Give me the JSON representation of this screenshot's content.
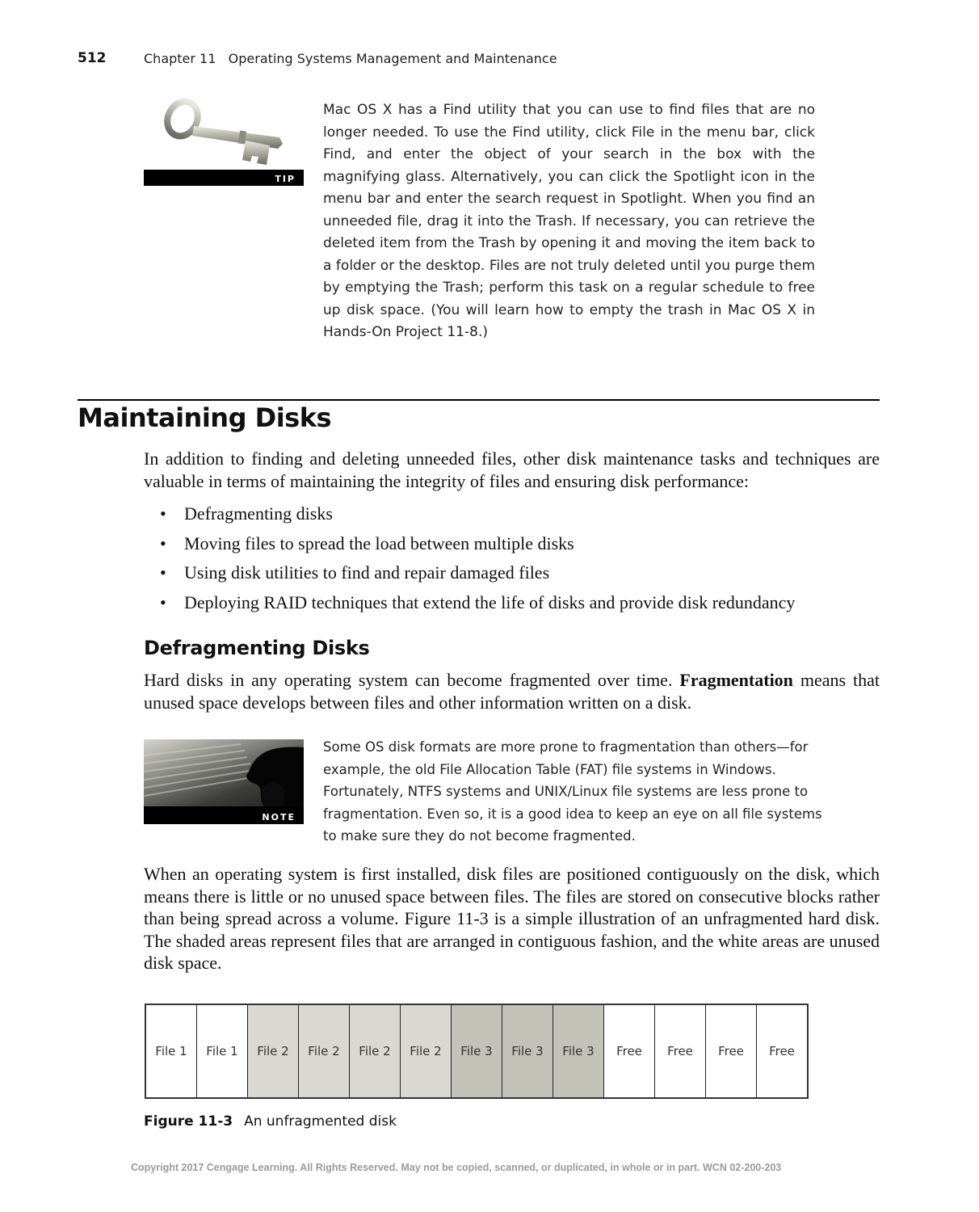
{
  "header": {
    "page_number": "512",
    "chapter_title": "Chapter 11   Operating Systems Management and Maintenance"
  },
  "tip": {
    "icon": "key-icon",
    "badge": "TIP",
    "text": "Mac OS X has a Find utility that you can use to find files that are no longer needed. To use the Find utility, click File in the menu bar, click Find, and enter the object of your search in the box with the magnifying glass. Alternatively, you can click the Spotlight icon in the menu bar and enter the search request in Spotlight. When you find an unneeded file, drag it into the Trash. If necessary, you can retrieve the deleted item from the Trash by opening it and moving the item back to a folder or the desktop. Files are not truly deleted until you purge them by emptying the Trash; perform this task on a regular schedule to free up disk space. (You will learn how to empty the trash in Mac OS X in Hands-On Project 11-8.)"
  },
  "section": {
    "title": "Maintaining Disks",
    "intro": "In addition to finding and deleting unneeded files, other disk maintenance tasks and techniques are valuable in terms of maintaining the integrity of files and ensuring disk performance:",
    "bullets": [
      "Defragmenting disks",
      "Moving files to spread the load between multiple disks",
      "Using disk utilities to find and repair damaged files",
      "Deploying RAID techniques that extend the life of disks and provide disk redundancy"
    ]
  },
  "subsection": {
    "title": "Defragmenting Disks",
    "para_before": "Hard disks in any operating system can become fragmented over time. ",
    "term": "Fragmentation",
    "para_after": " means that unused space develops between files and other information written on a disk."
  },
  "note": {
    "icon": "keyboard-hand-icon",
    "badge": "NOTE",
    "text": "Some OS disk formats are more prone to fragmentation than others—for example, the old File Allocation Table (FAT) file systems in Windows. Fortunately, NTFS systems and UNIX/Linux file systems are less prone to fragmentation. Even so, it is a good idea to keep an eye on all file systems to make sure they do not become fragmented."
  },
  "install_para": "When an operating system is first installed, disk files are positioned contiguously on the disk, which means there is little or no unused space between files. The files are stored on consecutive blocks rather than being spread across a volume. Figure 11-3 is a simple illustration of an unfragmented hard disk. The shaded areas represent files that are arranged in contiguous fashion, and the white areas are unused disk space.",
  "figure": {
    "blocks": [
      {
        "label": "File 1",
        "color": "#ffffff"
      },
      {
        "label": "File 1",
        "color": "#ffffff"
      },
      {
        "label": "File 2",
        "color": "#d9d9d1"
      },
      {
        "label": "File 2",
        "color": "#d9d9d1"
      },
      {
        "label": "File 2",
        "color": "#d9d9d1"
      },
      {
        "label": "File 2",
        "color": "#d9d9d1"
      },
      {
        "label": "File 3",
        "color": "#c2c2b8"
      },
      {
        "label": "File 3",
        "color": "#c2c2b8"
      },
      {
        "label": "File 3",
        "color": "#c2c2b8"
      },
      {
        "label": "Free",
        "color": "#ffffff"
      },
      {
        "label": "Free",
        "color": "#ffffff"
      },
      {
        "label": "Free",
        "color": "#ffffff"
      },
      {
        "label": "Free",
        "color": "#ffffff"
      }
    ],
    "caption_number": "Figure 11-3",
    "caption_text": "An unfragmented disk"
  },
  "footer": {
    "copyright": "Copyright 2017 Cengage Learning. All Rights Reserved. May not be copied, scanned, or duplicated, in whole or in part.  WCN 02-200-203"
  }
}
